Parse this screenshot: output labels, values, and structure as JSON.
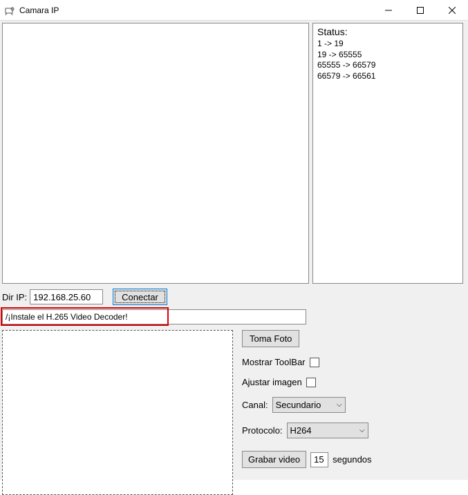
{
  "window": {
    "title": "Camara IP"
  },
  "status": {
    "title": "Status:",
    "lines": "1 -> 19\n19 -> 65555\n65555 -> 66579\n66579 -> 66561"
  },
  "ip": {
    "label": "Dir IP:",
    "value": "192.168.25.60",
    "connect_label": "Conectar"
  },
  "message": {
    "value": "/¡Instale el H.265 Video Decoder!"
  },
  "controls": {
    "toma_foto": "Toma Foto",
    "mostrar_toolbar": "Mostrar ToolBar",
    "ajustar_imagen": "Ajustar imagen",
    "canal_label": "Canal:",
    "canal_value": "Secundario",
    "protocolo_label": "Protocolo:",
    "protocolo_value": "H264",
    "grabar_video": "Grabar video",
    "grabar_seconds": "15",
    "segundos": "segundos"
  }
}
